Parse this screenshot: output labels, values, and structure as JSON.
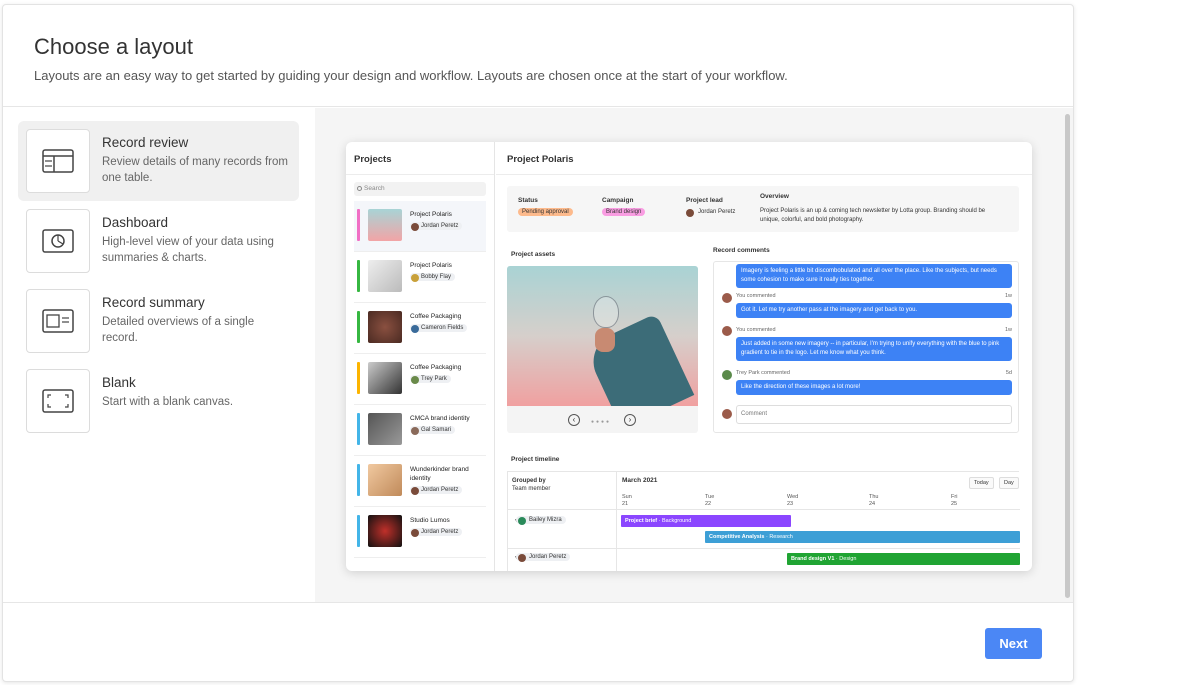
{
  "header": {
    "title": "Choose a layout",
    "subtitle": "Layouts are an easy way to get started by guiding your design and workflow. Layouts are chosen once at the start of your workflow."
  },
  "layouts": [
    {
      "name": "Record review",
      "description": "Review details of many records from one table.",
      "icon": "table-layout-icon",
      "selected": true
    },
    {
      "name": "Dashboard",
      "description": "High-level view of your data using summaries & charts.",
      "icon": "dashboard-chart-icon",
      "selected": false
    },
    {
      "name": "Record summary",
      "description": "Detailed overviews of a single record.",
      "icon": "record-card-icon",
      "selected": false
    },
    {
      "name": "Blank",
      "description": "Start with a blank canvas.",
      "icon": "blank-canvas-icon",
      "selected": false
    }
  ],
  "preview": {
    "list_title": "Projects",
    "search_placeholder": "Search",
    "items": [
      {
        "name": "Project Polaris",
        "person": "Jordan Peretz",
        "bar_color": "#f16fc5"
      },
      {
        "name": "Project Polaris",
        "person": "Bobby Flay",
        "bar_color": "#36b741"
      },
      {
        "name": "Coffee Packaging",
        "person": "Cameron Fields",
        "bar_color": "#36b741"
      },
      {
        "name": "Coffee Packaging",
        "person": "Trey Park",
        "bar_color": "#fcb400"
      },
      {
        "name": "CMCA brand identity",
        "person": "Gal Samari",
        "bar_color": "#43b5e8"
      },
      {
        "name": "Wunderkinder brand identity",
        "person": "Jordan Peretz",
        "bar_color": "#43b5e8"
      },
      {
        "name": "Studio Lumos",
        "person": "Jordan Peretz",
        "bar_color": "#43b5e8"
      }
    ],
    "detail_title": "Project Polaris",
    "fields": {
      "status_label": "Status",
      "status_value": "Pending approval",
      "campaign_label": "Campaign",
      "campaign_value": "Brand design",
      "lead_label": "Project lead",
      "lead_value": "Jordan Peretz",
      "overview_label": "Overview",
      "overview_value": "Project Polaris is an up & coming tech newsletter by Lotta group. Branding should be unique, colorful, and bold photography."
    },
    "assets_label": "Project assets",
    "comments_label": "Record comments",
    "comments": [
      {
        "text": "Imagery is feeling a little bit discombobulated and all over the place. Like the subjects, but needs some cohesion to make sure it really ties together."
      },
      {
        "author": "You commented",
        "time": "1w",
        "text": "Got it. Let me try another pass at the imagery and get back to you."
      },
      {
        "author": "You commented",
        "time": "1w",
        "text": "Just added in some new imagery -- in particular, I'm trying to unify everything with the blue to pink gradient to tie in the logo. Let me know what you think."
      },
      {
        "author": "Trey Park commented",
        "time": "5d",
        "text": "Like the direction of these images a lot more!"
      }
    ],
    "comment_placeholder": "Comment",
    "timeline": {
      "label": "Project timeline",
      "grouped_by": "Grouped by",
      "group_field": "Team member",
      "month": "March 2021",
      "today_button": "Today",
      "day_button": "Day",
      "days": [
        {
          "dow": "Sun",
          "date": "21"
        },
        {
          "dow": "Tue",
          "date": "22"
        },
        {
          "dow": "Wed",
          "date": "23"
        },
        {
          "dow": "Thu",
          "date": "24"
        },
        {
          "dow": "Fri",
          "date": "25"
        }
      ],
      "rows": [
        {
          "person": "Bailey Mizra"
        },
        {
          "person": "Jordan Peretz"
        }
      ],
      "bars": [
        {
          "title": "Project brief",
          "category": "Background",
          "color": "#8b46ff"
        },
        {
          "title": "Competitive Analysis",
          "category": "Research",
          "color": "#3d9fd6"
        },
        {
          "title": "Brand design V1",
          "category": "Design",
          "color": "#20a433"
        }
      ]
    }
  },
  "footer": {
    "next_label": "Next"
  },
  "colors": {
    "accent": "#4b87f5",
    "selected_bg": "#f0f0f0",
    "status_pill": "#fdba8c",
    "campaign_pill": "#f99de2"
  }
}
